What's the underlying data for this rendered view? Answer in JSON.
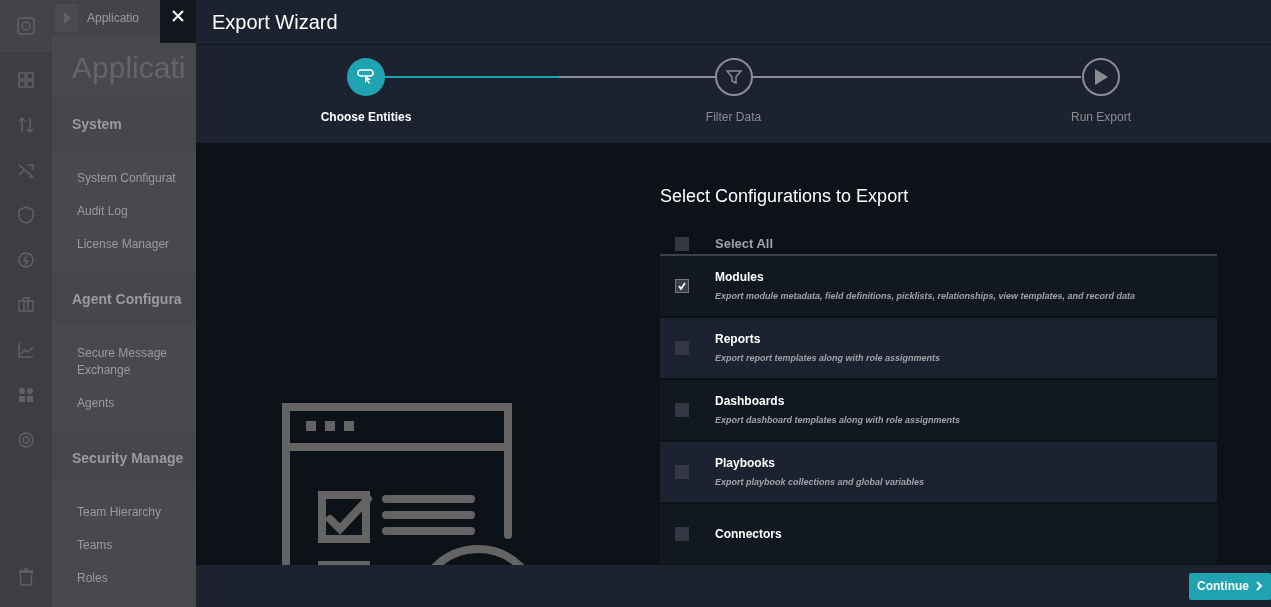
{
  "background_app": {
    "breadcrumb": "Applicatio",
    "heading": "Applicati",
    "sections": [
      {
        "title": "System",
        "items": [
          "System Configurat",
          "Audit Log",
          "License Manager"
        ]
      },
      {
        "title": "Agent Configura",
        "items": [
          "Secure Message Exchange",
          "Agents"
        ]
      },
      {
        "title": "Security Manage",
        "items": [
          "Team Hierarchy",
          "Teams",
          "Roles"
        ]
      }
    ]
  },
  "window": {
    "title": "Export Wizard"
  },
  "steps": [
    {
      "label": "Choose Entities",
      "selected": true
    },
    {
      "label": "Filter Data",
      "selected": false
    },
    {
      "label": "Run Export",
      "selected": false
    }
  ],
  "progress": {
    "level": 0.27
  },
  "content": {
    "title": "Select Configurations to Export",
    "select_all": {
      "label": "Select All",
      "checked": false
    },
    "items": [
      {
        "name": "Modules",
        "description": "Export module metadata, field definitions, picklists, relationships, view templates, and record data",
        "checked": true
      },
      {
        "name": "Reports",
        "description": "Export report templates along with role assignments",
        "checked": false
      },
      {
        "name": "Dashboards",
        "description": "Export dashboard templates along with role assignments",
        "checked": false
      },
      {
        "name": "Playbooks",
        "description": "Export playbook collections and global variables",
        "checked": false
      },
      {
        "name": "Connectors",
        "checked": false
      }
    ]
  },
  "footer": {
    "button": "Continue"
  }
}
